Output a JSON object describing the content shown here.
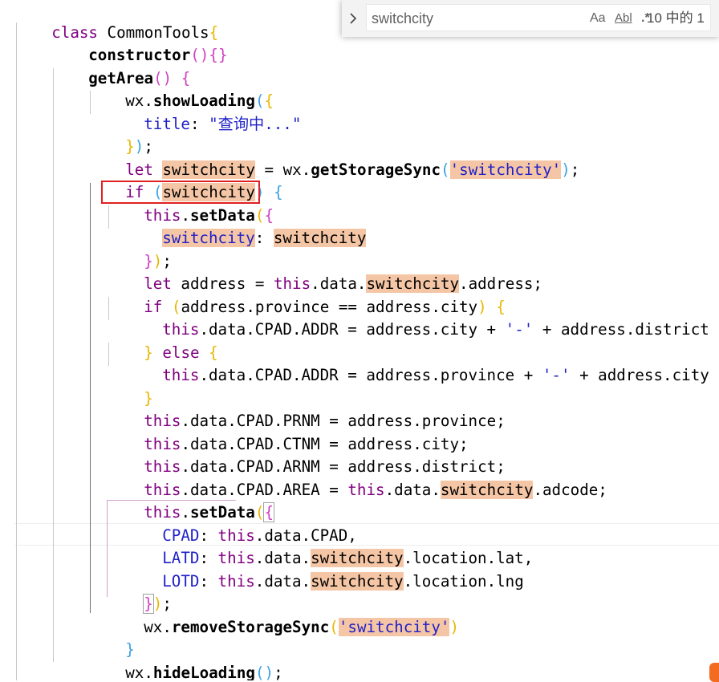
{
  "find": {
    "query": "switchcity",
    "match_case_label": "Aa",
    "whole_word_label": "Abl",
    "regex_label": ".*",
    "result_count": "10 中的 1"
  },
  "code": {
    "l1": {
      "a": "class",
      "b": " CommonTools",
      "c": "{"
    },
    "l2": {
      "a": "constructor",
      "b": "()",
      "c": "{}"
    },
    "l3": {
      "a": "getArea",
      "b": "()",
      "c": " {"
    },
    "l4": {
      "a": "wx.",
      "b": "showLoading",
      "c": "(",
      "d": "{"
    },
    "l5": {
      "a": "title",
      "b": ": ",
      "c": "\"查询中...\""
    },
    "l6": {
      "a": "}",
      "b": ")",
      "c": ";"
    },
    "l7": {
      "a": "let",
      "b": " ",
      "c": "switchcity",
      "d": " = wx.",
      "e": "getStorageSync",
      "f": "(",
      "g": "'",
      "h": "switchcity",
      "i": "'",
      "j": ")",
      "k": ";"
    },
    "l8": {
      "a": "if",
      "b": " ",
      "c": "(",
      "d": "switchcity",
      "e": ")",
      "f": " {"
    },
    "l9": {
      "a": "this",
      "b": ".",
      "c": "setData",
      "d": "(",
      "e": "{"
    },
    "l10": {
      "a": "switchcity",
      "b": ": ",
      "c": "switchcity"
    },
    "l11": {
      "a": "}",
      "b": ")",
      "c": ";"
    },
    "l12": {
      "a": "let",
      "b": " address = ",
      "c": "this",
      "d": ".data.",
      "e": "switchcity",
      "f": ".address;"
    },
    "l13": {
      "a": "if",
      "b": " ",
      "c": "(",
      "d": "address.province == address.city",
      "e": ")",
      "f": " {"
    },
    "l14": {
      "a": "this",
      "b": ".data.CPAD.ADDR = address.city + ",
      "c": "'-'",
      "d": " + address.district"
    },
    "l15": {
      "a": "}",
      "b": " ",
      "c": "else",
      "d": " {"
    },
    "l16": {
      "a": "this",
      "b": ".data.CPAD.ADDR = address.province + ",
      "c": "'-'",
      "d": " + address.city + ",
      "e": "'-"
    },
    "l17": {
      "a": "}"
    },
    "l18": {
      "a": "this",
      "b": ".data.CPAD.PRNM = address.province;"
    },
    "l19": {
      "a": "this",
      "b": ".data.CPAD.CTNM = address.city;"
    },
    "l20": {
      "a": "this",
      "b": ".data.CPAD.ARNM = address.district;"
    },
    "l21": {
      "a": "this",
      "b": ".data.CPAD.AREA = ",
      "c": "this",
      "d": ".data.",
      "e": "switchcity",
      "f": ".adcode;"
    },
    "l22": {
      "a": "this",
      "b": ".",
      "c": "setData",
      "d": "(",
      "e": "{"
    },
    "l23": {
      "a": "CPAD",
      "b": ": ",
      "c": "this",
      "d": ".data.CPAD,"
    },
    "l24": {
      "a": "LATD",
      "b": ": ",
      "c": "this",
      "d": ".data.",
      "e": "switchcity",
      "f": ".location.lat,"
    },
    "l25": {
      "a": "LOTD",
      "b": ": ",
      "c": "this",
      "d": ".data.",
      "e": "switchcity",
      "f": ".location.lng"
    },
    "l26": {
      "a": "}",
      "b": ")",
      "c": ";"
    },
    "l27": {
      "a": "wx.",
      "b": "removeStorageSync",
      "c": "(",
      "d": "'",
      "e": "switchcity",
      "f": "'",
      "g": ")"
    },
    "l28": {
      "a": "}"
    },
    "l29": {
      "a": "wx.",
      "b": "hideLoading",
      "c": "()",
      "d": ";"
    },
    "l30": {
      "a": "}"
    }
  },
  "colors": {
    "keyword": "#800080",
    "property": "#1f1fc8",
    "string": "#1f1fc8",
    "bracket_level1": "#e6b800",
    "bracket_level2": "#d040c0",
    "bracket_level3": "#3aa0e0",
    "match_highlight": "#f5c6a5",
    "selection_box": "#e02020",
    "corner_badge": "#f26b21"
  },
  "icons": {
    "find_toggle": "chevron-right-icon",
    "corner_badge": "app-badge-icon"
  }
}
